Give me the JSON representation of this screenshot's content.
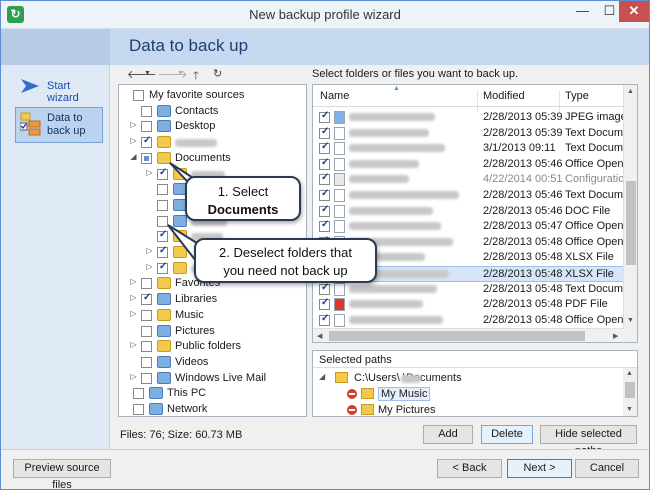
{
  "window": {
    "title": "New backup profile wizard"
  },
  "header": {
    "page_title": "Data to back up"
  },
  "nav": {
    "start_wizard": "Start wizard",
    "data_to_back_up": "Data to\nback up"
  },
  "hint": "Select folders or files you want to back up.",
  "tree": [
    {
      "label": "My favorite sources",
      "level": 0,
      "check": "none",
      "expander": "",
      "icon": "none"
    },
    {
      "label": "Contacts",
      "level": 1,
      "check": "none",
      "expander": "",
      "icon": "folder-blue"
    },
    {
      "label": "Desktop",
      "level": 1,
      "check": "none",
      "expander": "▷",
      "icon": "desktop"
    },
    {
      "label": "",
      "level": 1,
      "check": "checked",
      "expander": "▷",
      "icon": "user",
      "blurred": true
    },
    {
      "label": "Documents",
      "level": 1,
      "check": "partial",
      "expander": "◢",
      "icon": "docs"
    },
    {
      "label": "",
      "level": 2,
      "check": "checked",
      "expander": "▷",
      "icon": "folder",
      "blurred": true
    },
    {
      "label": "",
      "level": 2,
      "check": "none",
      "expander": "",
      "icon": "app",
      "blurred": true
    },
    {
      "label": "",
      "level": 2,
      "check": "none",
      "expander": "",
      "icon": "app",
      "blurred": true
    },
    {
      "label": "",
      "level": 2,
      "check": "none",
      "expander": "",
      "icon": "app",
      "blurred": true
    },
    {
      "label": "",
      "level": 2,
      "check": "checked",
      "expander": "",
      "icon": "folder",
      "blurred": true
    },
    {
      "label": "",
      "level": 2,
      "check": "checked",
      "expander": "▷",
      "icon": "folder",
      "blurred": true
    },
    {
      "label": "",
      "level": 2,
      "check": "checked",
      "expander": "▷",
      "icon": "folder",
      "blurred": true
    },
    {
      "label": "Favorites",
      "level": 1,
      "check": "none",
      "expander": "▷",
      "icon": "folder"
    },
    {
      "label": "Libraries",
      "level": 1,
      "check": "checked",
      "expander": "▷",
      "icon": "folder-blue"
    },
    {
      "label": "Music",
      "level": 1,
      "check": "none",
      "expander": "▷",
      "icon": "music"
    },
    {
      "label": "Pictures",
      "level": 1,
      "check": "none",
      "expander": "",
      "icon": "pictures"
    },
    {
      "label": "Public folders",
      "level": 1,
      "check": "none",
      "expander": "▷",
      "icon": "folder"
    },
    {
      "label": "Videos",
      "level": 1,
      "check": "none",
      "expander": "",
      "icon": "videos"
    },
    {
      "label": "Windows Live Mail",
      "level": 1,
      "check": "none",
      "expander": "▷",
      "icon": "mail"
    },
    {
      "label": "This PC",
      "level": 0,
      "check": "none",
      "expander": "",
      "icon": "pc"
    },
    {
      "label": "Network",
      "level": 0,
      "check": "none",
      "expander": "",
      "icon": "network"
    }
  ],
  "list": {
    "columns": [
      "Name",
      "Modified",
      "Type"
    ],
    "rows": [
      {
        "modified": "2/28/2013 05:39",
        "type": "JPEG image",
        "checked": true,
        "icon": "image"
      },
      {
        "modified": "2/28/2013 05:39",
        "type": "Text Document",
        "checked": true,
        "icon": "text"
      },
      {
        "modified": "3/1/2013 09:11",
        "type": "Text Document",
        "checked": true,
        "icon": "text"
      },
      {
        "modified": "2/28/2013 05:46",
        "type": "Office Open XML",
        "checked": true,
        "icon": "office"
      },
      {
        "modified": "4/22/2014 00:51",
        "type": "Configuration",
        "checked": true,
        "icon": "config",
        "grey": true
      },
      {
        "modified": "2/28/2013 05:46",
        "type": "Text Document",
        "checked": true,
        "icon": "text"
      },
      {
        "modified": "2/28/2013 05:46",
        "type": "DOC File",
        "checked": true,
        "icon": "doc"
      },
      {
        "modified": "2/28/2013 05:47",
        "type": "Office Open XML",
        "checked": true,
        "icon": "office"
      },
      {
        "modified": "2/28/2013 05:48",
        "type": "Office Open XML",
        "checked": true,
        "icon": "office"
      },
      {
        "modified": "2/28/2013 05:48",
        "type": "XLSX File",
        "checked": true,
        "icon": "xlsx"
      },
      {
        "modified": "2/28/2013 05:48",
        "type": "XLSX File",
        "checked": true,
        "icon": "xlsx",
        "selected": true
      },
      {
        "modified": "2/28/2013 05:48",
        "type": "Text Document",
        "checked": true,
        "icon": "text"
      },
      {
        "modified": "2/28/2013 05:48",
        "type": "PDF File",
        "checked": true,
        "icon": "pdf"
      },
      {
        "modified": "2/28/2013 05:48",
        "type": "Office Open XML",
        "checked": true,
        "icon": "office"
      },
      {
        "modified": "2/28/2013 05:48",
        "type": "Office Open XML",
        "checked": true,
        "icon": "office"
      }
    ]
  },
  "selected_paths": {
    "header": "Selected paths",
    "items": [
      {
        "label": "C:\\Users\\ \\Documents",
        "type": "root"
      },
      {
        "label": "My Music",
        "type": "excluded",
        "selected": true
      },
      {
        "label": "My Pictures",
        "type": "excluded"
      }
    ]
  },
  "files_info": "Files: 76; Size: 60.73 MB",
  "buttons": {
    "add": "Add",
    "delete": "Delete",
    "hide_selected_paths": "Hide selected paths",
    "preview_source_files": "Preview source files",
    "back": "< Back",
    "next": "Next >",
    "cancel": "Cancel"
  },
  "callouts": {
    "select_line1": "1. Select",
    "select_line2": "Documents",
    "deselect_line1": "2. Deselect folders that",
    "deselect_line2": "you need not back up"
  },
  "colors": {
    "accent": "#1b4aa8",
    "header_band": "#c6d8ef",
    "nav_bg": "#dfe9f6",
    "close_button": "#c75050"
  }
}
